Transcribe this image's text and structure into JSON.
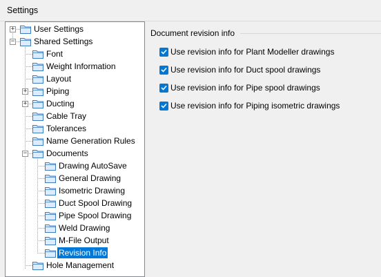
{
  "window": {
    "title": "Settings"
  },
  "tree": {
    "items": [
      {
        "label": "User Settings",
        "level": 0,
        "expander": "+"
      },
      {
        "label": "Shared Settings",
        "level": 0,
        "expander": "−"
      },
      {
        "label": "Font",
        "level": 1,
        "expander": ""
      },
      {
        "label": "Weight Information",
        "level": 1,
        "expander": ""
      },
      {
        "label": "Layout",
        "level": 1,
        "expander": ""
      },
      {
        "label": "Piping",
        "level": 1,
        "expander": "+"
      },
      {
        "label": "Ducting",
        "level": 1,
        "expander": "+"
      },
      {
        "label": "Cable Tray",
        "level": 1,
        "expander": ""
      },
      {
        "label": "Tolerances",
        "level": 1,
        "expander": ""
      },
      {
        "label": "Name Generation Rules",
        "level": 1,
        "expander": ""
      },
      {
        "label": "Documents",
        "level": 1,
        "expander": "−"
      },
      {
        "label": "Drawing AutoSave",
        "level": 2,
        "expander": ""
      },
      {
        "label": "General Drawing",
        "level": 2,
        "expander": ""
      },
      {
        "label": "Isometric Drawing",
        "level": 2,
        "expander": ""
      },
      {
        "label": "Duct Spool Drawing",
        "level": 2,
        "expander": ""
      },
      {
        "label": "Pipe Spool Drawing",
        "level": 2,
        "expander": ""
      },
      {
        "label": "Weld Drawing",
        "level": 2,
        "expander": ""
      },
      {
        "label": "M-File Output",
        "level": 2,
        "expander": ""
      },
      {
        "label": "Revision Info",
        "level": 2,
        "expander": "",
        "selected": true
      },
      {
        "label": "Hole Management",
        "level": 1,
        "expander": ""
      }
    ]
  },
  "panel": {
    "title": "Document revision info",
    "options": [
      {
        "label": "Use revision info for Plant Modeller drawings",
        "checked": true
      },
      {
        "label": "Use revision info for Duct spool drawings",
        "checked": true
      },
      {
        "label": "Use revision info for Pipe spool drawings",
        "checked": true
      },
      {
        "label": "Use revision info for Piping isometric drawings",
        "checked": true
      }
    ]
  },
  "colors": {
    "accent": "#0078d7",
    "folder_fill": "#dcecfc",
    "folder_stroke": "#3b7bbf"
  },
  "icons": {
    "folder": "folder-icon",
    "check": "check-icon",
    "expand": "expand-icon",
    "collapse": "collapse-icon"
  }
}
